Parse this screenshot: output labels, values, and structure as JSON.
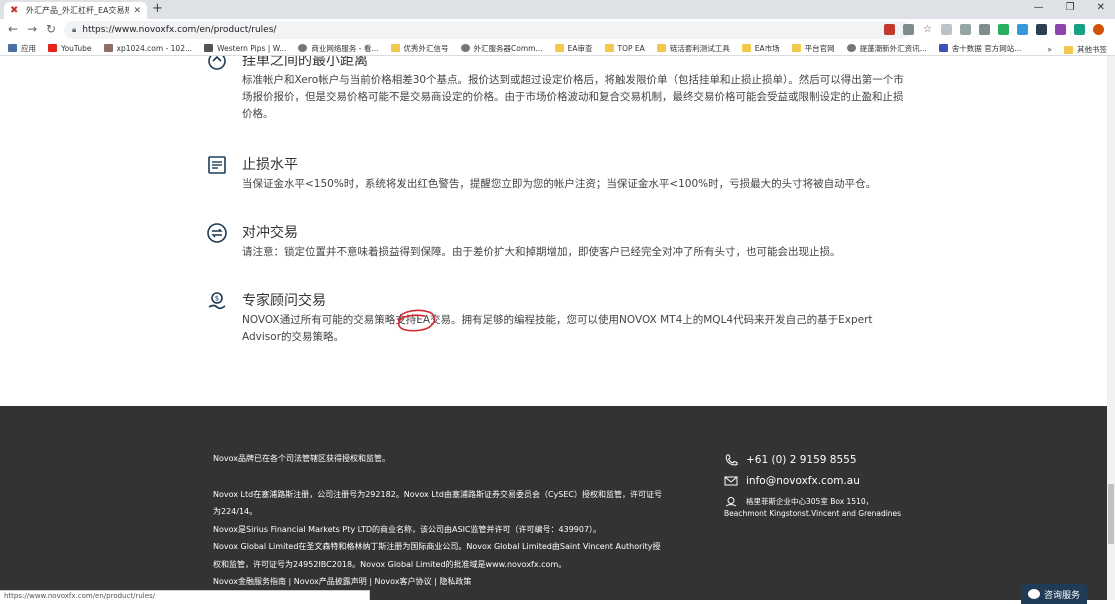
{
  "browser": {
    "tab_title": "外汇产品_外汇杠杆_EA交易规则_",
    "url": "https://www.novoxfx.com/en/product/rules/",
    "url_domain": "https://www.novoxfx.com",
    "url_path": "/en/product/rules/"
  },
  "bookmarks": [
    {
      "label": "应用",
      "icon": "apps-grid-icon"
    },
    {
      "label": "YouTube",
      "icon": "youtube-icon"
    },
    {
      "label": "xp1024.com - 102...",
      "icon": "site-icon"
    },
    {
      "label": "Western Pips | W...",
      "icon": "site-icon"
    },
    {
      "label": "商业网络服务 - 看...",
      "icon": "globe-icon"
    },
    {
      "label": "优秀外汇信号",
      "icon": "folder-icon"
    },
    {
      "label": "外汇服务器Comm...",
      "icon": "globe-icon"
    },
    {
      "label": "EA审查",
      "icon": "folder-icon"
    },
    {
      "label": "TOP EA",
      "icon": "folder-icon"
    },
    {
      "label": "链活套利测试工具",
      "icon": "folder-icon"
    },
    {
      "label": "EA市场",
      "icon": "folder-icon"
    },
    {
      "label": "平台官网",
      "icon": "folder-icon"
    },
    {
      "label": "提蓬潮新外汇资讯...",
      "icon": "globe-icon"
    },
    {
      "label": "舍十数据 官方网站...",
      "icon": "site-icon"
    }
  ],
  "bookmarks_more": "»",
  "bookmarks_other": "其他书签",
  "features": [
    {
      "title": "挂单之间的最小距离",
      "desc": "标准帐户和Xero帐户与当前价格相差30个基点。报价达到或超过设定价格后，将触发限价单（包括挂单和止损止损单）。然后可以得出第一个市场报价报价，但是交易价格可能不是交易商设定的价格。由于市场价格波动和复合交易机制，最终交易价格可能会受益或限制设定的止盈和止损价格。"
    },
    {
      "title": "止损水平",
      "desc": "当保证金水平<150%时，系统将发出红色警告，提醒您立即为您的帐户注资；当保证金水平<100%时，亏损最大的头寸将被自动平仓。"
    },
    {
      "title": "对冲交易",
      "desc": "请注意：锁定位置并不意味着损益得到保障。由于差价扩大和掉期增加，即使客户已经完全对冲了所有头寸，也可能会出现止损。"
    },
    {
      "title": "专家顾问交易",
      "desc": "NOVOX通过所有可能的交易策略支持EA交易。拥有足够的编程技能，您可以使用NOVOX MT4上的MQL4代码来开发自己的基于Expert Advisor的交易策略。"
    }
  ],
  "footer": {
    "line1": "Novox品牌已在各个司法管辖区获得授权和监管。",
    "line2": "Novox Ltd在塞浦路斯注册，公司注册号为292182。Novox Ltd由塞浦路斯证券交易委员会（CySEC）授权和监管，许可证号为224/14。",
    "line3": "Novox是Sirius Financial Markets Pty LTD的商业名称，该公司由ASIC监管并许可（许可编号：439907）。",
    "line4": "Novox Global Limited在圣文森特和格林纳丁斯注册为国际商业公司。Novox Global Limited由Saint Vincent Authority授权和监管，许可证号为24952IBC2018。Novox Global Limited的批准域是www.novoxfx.com。",
    "links": "Novox金融服务指南 | Novox产品披露声明 | Novox客户协议 | 隐私政策",
    "phone": "+61  (0)  2 9159 8555",
    "email": "info@novoxfx.com.au",
    "address1": "格里菲斯企业中心305室 Box 1510，",
    "address2": "Beachmont Kingstonst.Vincent and Grenadines"
  },
  "chat_label": "咨询服务",
  "status_url": "https://www.novoxfx.com/en/product/rules/",
  "colors": {
    "footer_bg": "#333333",
    "chat_bg": "#1f3b57",
    "annotation_red": "#d0282e"
  }
}
